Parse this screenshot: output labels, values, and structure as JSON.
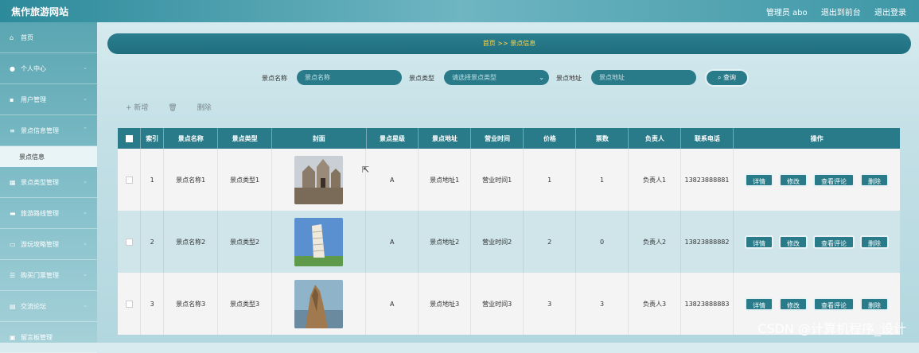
{
  "header": {
    "title": "焦作旅游网站",
    "admin": "管理员 abo",
    "to_front": "退出到前台",
    "logout": "退出登录"
  },
  "sidebar": {
    "items": [
      {
        "label": "首页",
        "icon": "home-icon"
      },
      {
        "label": "个人中心",
        "icon": "user-icon"
      },
      {
        "label": "用户管理",
        "icon": "user-group-icon"
      },
      {
        "label": "景点信息管理",
        "icon": "sliders-icon"
      },
      {
        "label": "景点类型管理",
        "icon": "grid-icon"
      },
      {
        "label": "旅游路线管理",
        "icon": "route-icon"
      },
      {
        "label": "游玩攻略管理",
        "icon": "monitor-icon"
      },
      {
        "label": "购买门票管理",
        "icon": "list-icon"
      },
      {
        "label": "交流论坛",
        "icon": "forum-icon"
      },
      {
        "label": "留言板管理",
        "icon": "message-icon"
      }
    ],
    "sub_item": "景点信息"
  },
  "breadcrumb": {
    "text": "首页  >>  景点信息"
  },
  "search": {
    "name_label": "景点名称",
    "name_placeholder": "景点名称",
    "type_label": "景点类型",
    "type_placeholder": "请选择景点类型",
    "address_label": "景点地址",
    "address_placeholder": "景点地址",
    "query_button": "查询"
  },
  "actions": {
    "add": "+ 新增",
    "delete": "删除"
  },
  "table": {
    "headers": [
      "索引",
      "景点名称",
      "景点类型",
      "封面",
      "景点星级",
      "景点地址",
      "营业时间",
      "价格",
      "票数",
      "负责人",
      "联系电话",
      "操作"
    ],
    "rows": [
      {
        "index": "1",
        "name": "景点名称1",
        "type": "景点类型1",
        "cover": "castle",
        "star": "A",
        "address": "景点地址1",
        "hours": "营业时间1",
        "price": "1",
        "tickets": "1",
        "owner": "负责人1",
        "phone": "13823888881"
      },
      {
        "index": "2",
        "name": "景点名称2",
        "type": "景点类型2",
        "cover": "tower",
        "star": "A",
        "address": "景点地址2",
        "hours": "营业时间2",
        "price": "2",
        "tickets": "0",
        "owner": "负责人2",
        "phone": "13823888882"
      },
      {
        "index": "3",
        "name": "景点名称3",
        "type": "景点类型3",
        "cover": "cliff",
        "star": "A",
        "address": "景点地址3",
        "hours": "营业时间3",
        "price": "3",
        "tickets": "3",
        "owner": "负责人3",
        "phone": "13823888883"
      }
    ],
    "row_buttons": {
      "detail": "详情",
      "edit": "修改",
      "comments": "查看评论",
      "delete": "删除"
    }
  },
  "watermark": "CSDN @计算机程序_设计",
  "colors": {
    "primary": "#2a7b8a",
    "breadcrumb_text": "#ffd84a"
  }
}
